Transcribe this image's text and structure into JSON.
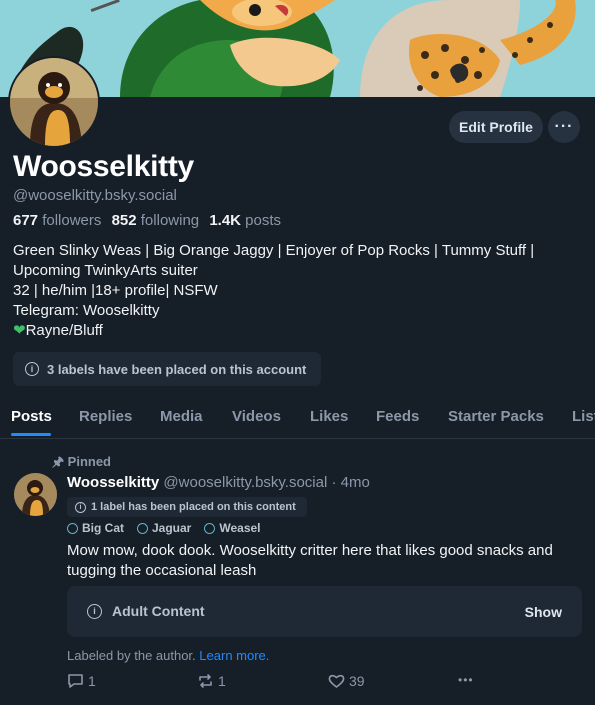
{
  "profile": {
    "display_name": "Woosselkitty",
    "handle": "@wooselkitty.bsky.social",
    "followers_count": "677",
    "followers_label": "followers",
    "following_count": "852",
    "following_label": "following",
    "posts_count": "1.4K",
    "posts_label": "posts",
    "bio_lines": [
      "Green Slinky Weas | Big Orange Jaggy | Enjoyer of Pop Rocks | Tummy Stuff |",
      "Upcoming TwinkyArts suiter",
      "32 | he/him |18+ profile| NSFW",
      "Telegram: Wooselkitty",
      "Rayne/Bluff"
    ],
    "bio_heart_icon": "green-heart-icon",
    "labels_notice": "3 labels have been placed on this account",
    "edit_button": "Edit Profile",
    "more_button": "···"
  },
  "tabs": [
    "Posts",
    "Replies",
    "Media",
    "Videos",
    "Likes",
    "Feeds",
    "Starter Packs",
    "Lists"
  ],
  "active_tab": "Posts",
  "post": {
    "pinned_label": "Pinned",
    "author": "Woosselkitty",
    "handle": "@wooselkitty.bsky.social",
    "time": "· 4mo",
    "content_label_notice": "1 label has been placed on this content",
    "tags": [
      "Big Cat",
      "Jaguar",
      "Weasel"
    ],
    "text": "Mow mow, dook dook. Wooselkitty critter here that likes good snacks and tugging the occasional leash",
    "warning_label": "Adult Content",
    "warning_show": "Show",
    "labeled_by": "Labeled by the author.",
    "learn_more": "Learn more.",
    "replies": "1",
    "reposts": "1",
    "likes": "39",
    "more": "•••"
  },
  "colors": {
    "background": "#161e27",
    "accent": "#208bfe",
    "muted": "#8b98a9",
    "banner": "#8fd3da"
  }
}
